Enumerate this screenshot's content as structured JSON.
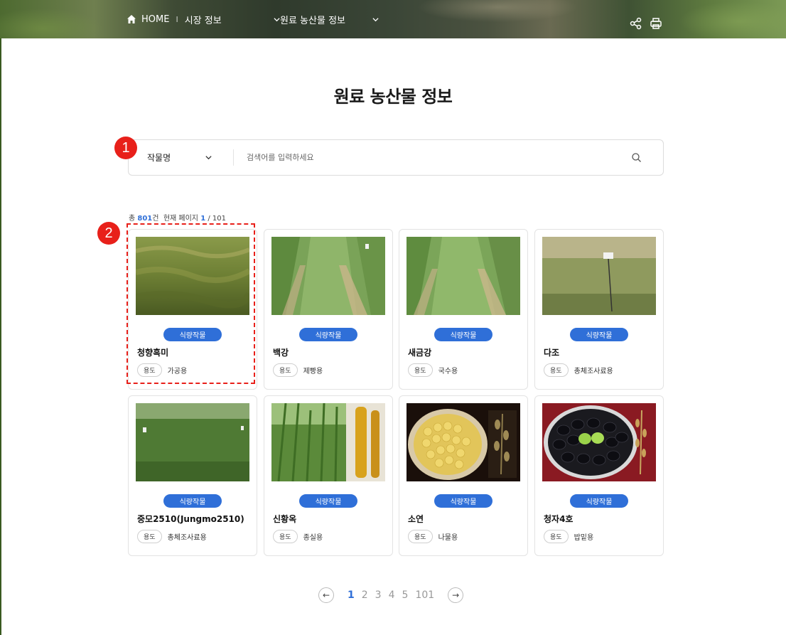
{
  "nav": {
    "home_label": "HOME",
    "separator": "I",
    "market_label": "시장 정보",
    "current_label": "원료 농산물 정보"
  },
  "title": "원료 농산물 정보",
  "search": {
    "category_selected": "작물명",
    "placeholder": "검색어를 입력하세요"
  },
  "callouts": [
    "1",
    "2"
  ],
  "count": {
    "prefix": "총",
    "total": "801",
    "unit": "건",
    "page_label": "현재 페이지",
    "current_page": "1",
    "total_pages": "/ 101"
  },
  "cards": [
    {
      "category": "식량작물",
      "name": "청향흑미",
      "usage_tag": "용도",
      "usage": "가공용"
    },
    {
      "category": "식량작물",
      "name": "백강",
      "usage_tag": "용도",
      "usage": "제빵용"
    },
    {
      "category": "식량작물",
      "name": "새금강",
      "usage_tag": "용도",
      "usage": "국수용"
    },
    {
      "category": "식량작물",
      "name": "다조",
      "usage_tag": "용도",
      "usage": "총체조사료용"
    },
    {
      "category": "식량작물",
      "name": "중모2510(Jungmo2510)",
      "usage_tag": "용도",
      "usage": "총체조사료용"
    },
    {
      "category": "식량작물",
      "name": "신황옥",
      "usage_tag": "용도",
      "usage": "종실용"
    },
    {
      "category": "식량작물",
      "name": "소연",
      "usage_tag": "용도",
      "usage": "나물용"
    },
    {
      "category": "식량작물",
      "name": "청자4호",
      "usage_tag": "용도",
      "usage": "밥밑용"
    }
  ],
  "pagination": {
    "pages": [
      "1",
      "2",
      "3",
      "4",
      "5",
      "101"
    ],
    "active": "1",
    "prev_symbol": "←",
    "next_symbol": "→"
  },
  "colors": {
    "accent": "#2f6fd8",
    "callout": "#e8201a"
  }
}
